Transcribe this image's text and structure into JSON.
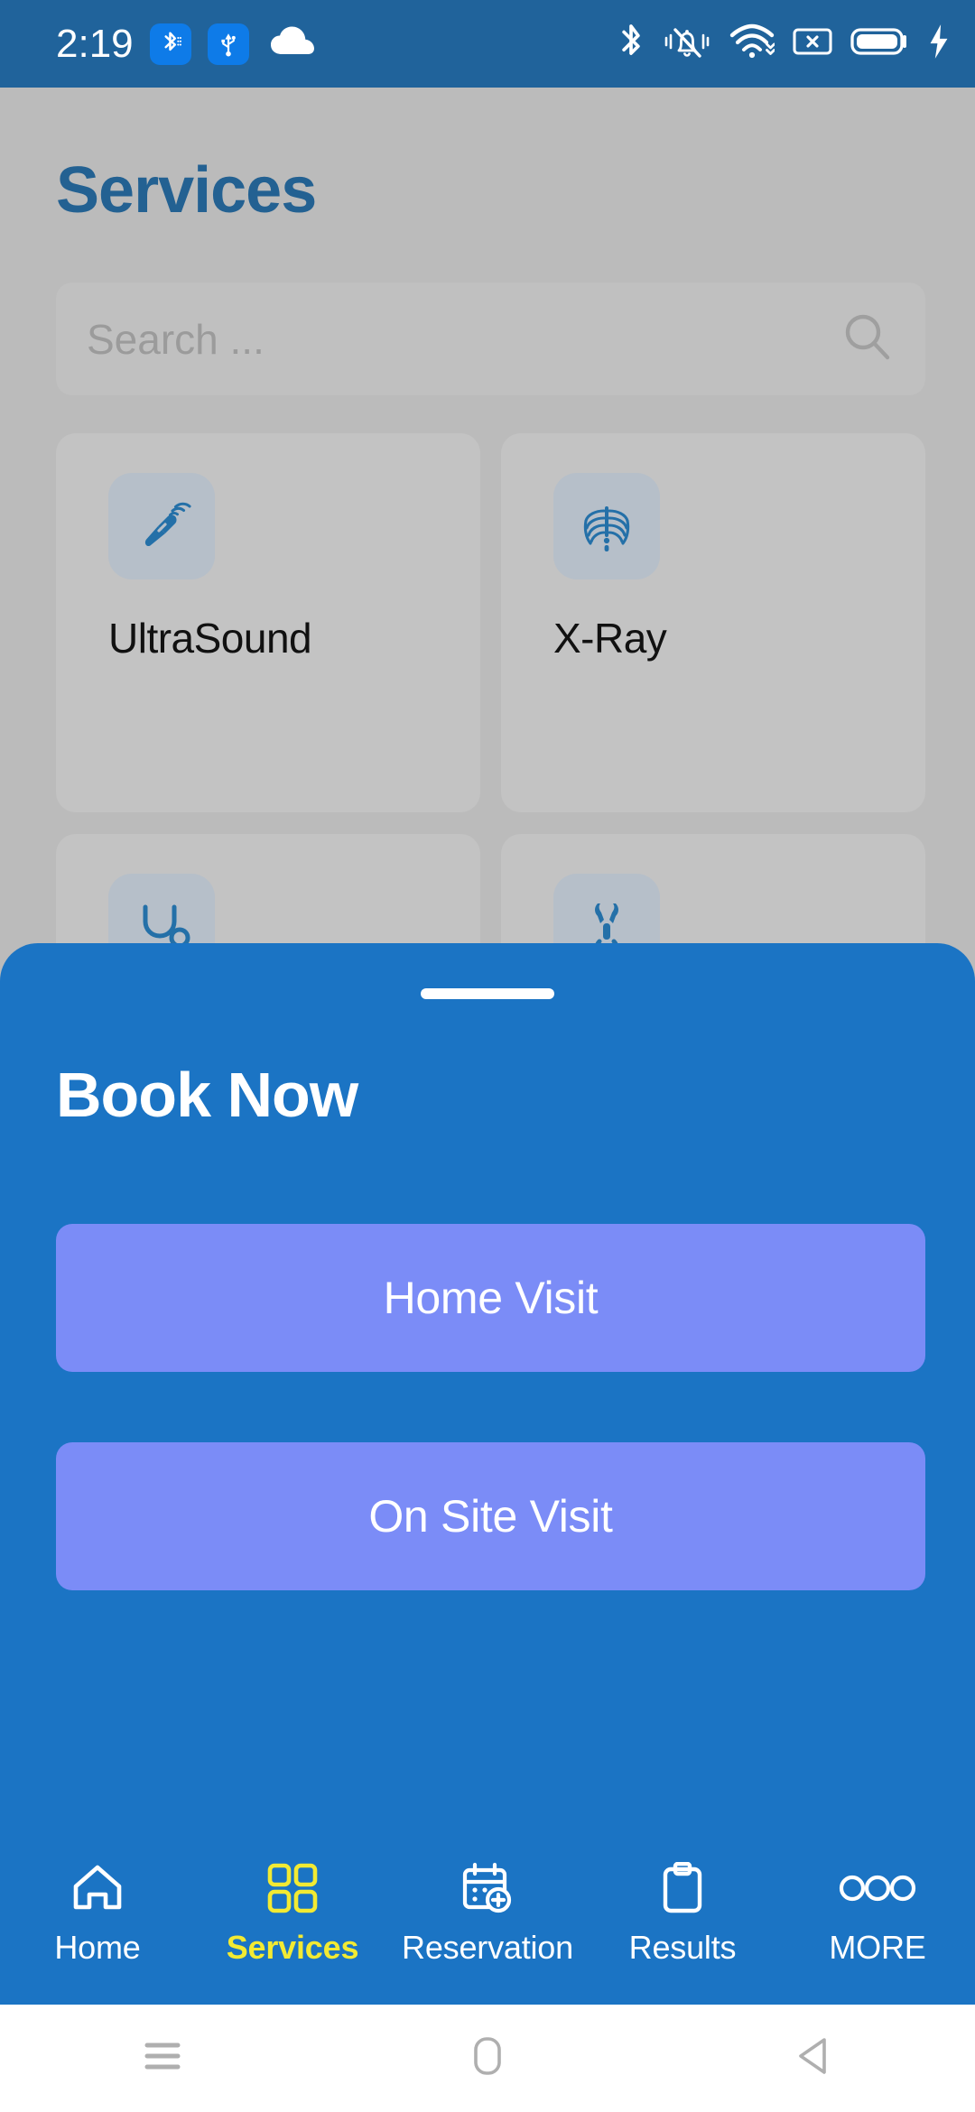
{
  "status_bar": {
    "time": "2:19",
    "left_icons": [
      {
        "name": "bluetooth-badge-icon",
        "glyph": "bluetooth-data"
      },
      {
        "name": "usb-badge-icon",
        "glyph": "usb"
      },
      {
        "name": "cloud-icon",
        "glyph": "cloud"
      }
    ],
    "right_icons": [
      {
        "name": "bluetooth-icon",
        "glyph": "bluetooth"
      },
      {
        "name": "vibrate-bell-icon",
        "glyph": "bell-muted"
      },
      {
        "name": "wifi-icon",
        "glyph": "wifi"
      },
      {
        "name": "sim-card-icon",
        "glyph": "no-sim"
      },
      {
        "name": "battery-icon",
        "glyph": "battery-full"
      },
      {
        "name": "charging-bolt-icon",
        "glyph": "bolt"
      }
    ],
    "colors": {
      "background": "#20639B",
      "foreground": "#FFFFFF",
      "badge": "#0E7BE8"
    }
  },
  "screen": {
    "title": "Services",
    "title_color": "#236192",
    "background_color": "#BBBBBB"
  },
  "search": {
    "placeholder": "Search ...",
    "icon": "search-icon",
    "value": ""
  },
  "services": [
    {
      "label": "UltraSound",
      "icon": "ultrasound-probe-icon"
    },
    {
      "label": "X-Ray",
      "icon": "ribcage-icon"
    },
    {
      "label": "",
      "icon": "stethoscope-icon"
    },
    {
      "label": "",
      "icon": "bone-joint-icon"
    }
  ],
  "sheet": {
    "title": "Book Now",
    "handle": "drag-handle",
    "background_color": "#1B74C4",
    "buttons": [
      {
        "label": "Home Visit",
        "color": "#7B8CF7"
      },
      {
        "label": "On Site Visit",
        "color": "#7B8CF7"
      }
    ]
  },
  "bottom_nav": {
    "active_color": "#F2EA33",
    "inactive_color": "#FFFFFF",
    "items": [
      {
        "label": "Home",
        "icon": "house-icon",
        "active": false
      },
      {
        "label": "Services",
        "icon": "grid-squares-icon",
        "active": true
      },
      {
        "label": "Reservation",
        "icon": "calendar-plus-icon",
        "active": false
      },
      {
        "label": "Results",
        "icon": "clipboard-icon",
        "active": false
      },
      {
        "label": "MORE",
        "icon": "three-circles-icon",
        "active": false
      }
    ]
  },
  "android_nav": {
    "buttons": [
      {
        "name": "recents-button",
        "icon": "hamburger-icon"
      },
      {
        "name": "home-button",
        "icon": "rounded-rect-icon"
      },
      {
        "name": "back-button",
        "icon": "triangle-left-icon"
      }
    ]
  }
}
